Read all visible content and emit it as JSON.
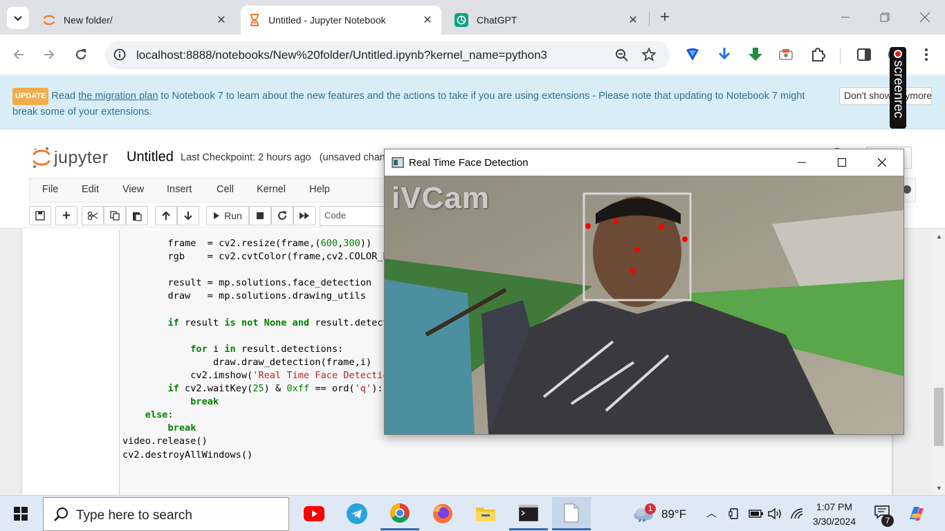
{
  "browser": {
    "tabs": [
      {
        "title": "New folder/",
        "active": false
      },
      {
        "title": "Untitled - Jupyter Notebook",
        "active": true
      },
      {
        "title": "ChatGPT",
        "active": false
      }
    ],
    "url": "localhost:8888/notebooks/New%20folder/Untitled.ipynb?kernel_name=python3"
  },
  "banner": {
    "badge": "UPDATE",
    "text_before": "Read ",
    "link": "the migration plan",
    "text_after": " to Notebook 7 to learn about the new features and the actions to take if you are using extensions - Please note that updating to Notebook 7 might break some of your extensions.",
    "dismiss": "Don't show anymore"
  },
  "screenrec": {
    "label": "screenrec"
  },
  "jupyter": {
    "logo": "jupyter",
    "notebook_name": "Untitled",
    "checkpoint": "Last Checkpoint: 2 hours ago",
    "status": "(unsaved changes)",
    "menu": [
      "File",
      "Edit",
      "View",
      "Insert",
      "Cell",
      "Kernel",
      "Help"
    ],
    "run_label": "Run",
    "cell_type": "Code"
  },
  "cv_window": {
    "title": "Real Time Face Detection",
    "watermark": "iVCam"
  },
  "taskbar": {
    "search_placeholder": "Type here to search",
    "weather": "89°F",
    "weather_badge": "1",
    "time": "1:07 PM",
    "date": "3/30/2024",
    "notification_count": "7"
  },
  "colors": {
    "banner_bg": "#d9edf7",
    "banner_text": "#31708f",
    "update_badge": "#f0ad4e",
    "keyword": "#008000",
    "string": "#ba2121",
    "taskbar_bg": "#dfe9f5"
  }
}
